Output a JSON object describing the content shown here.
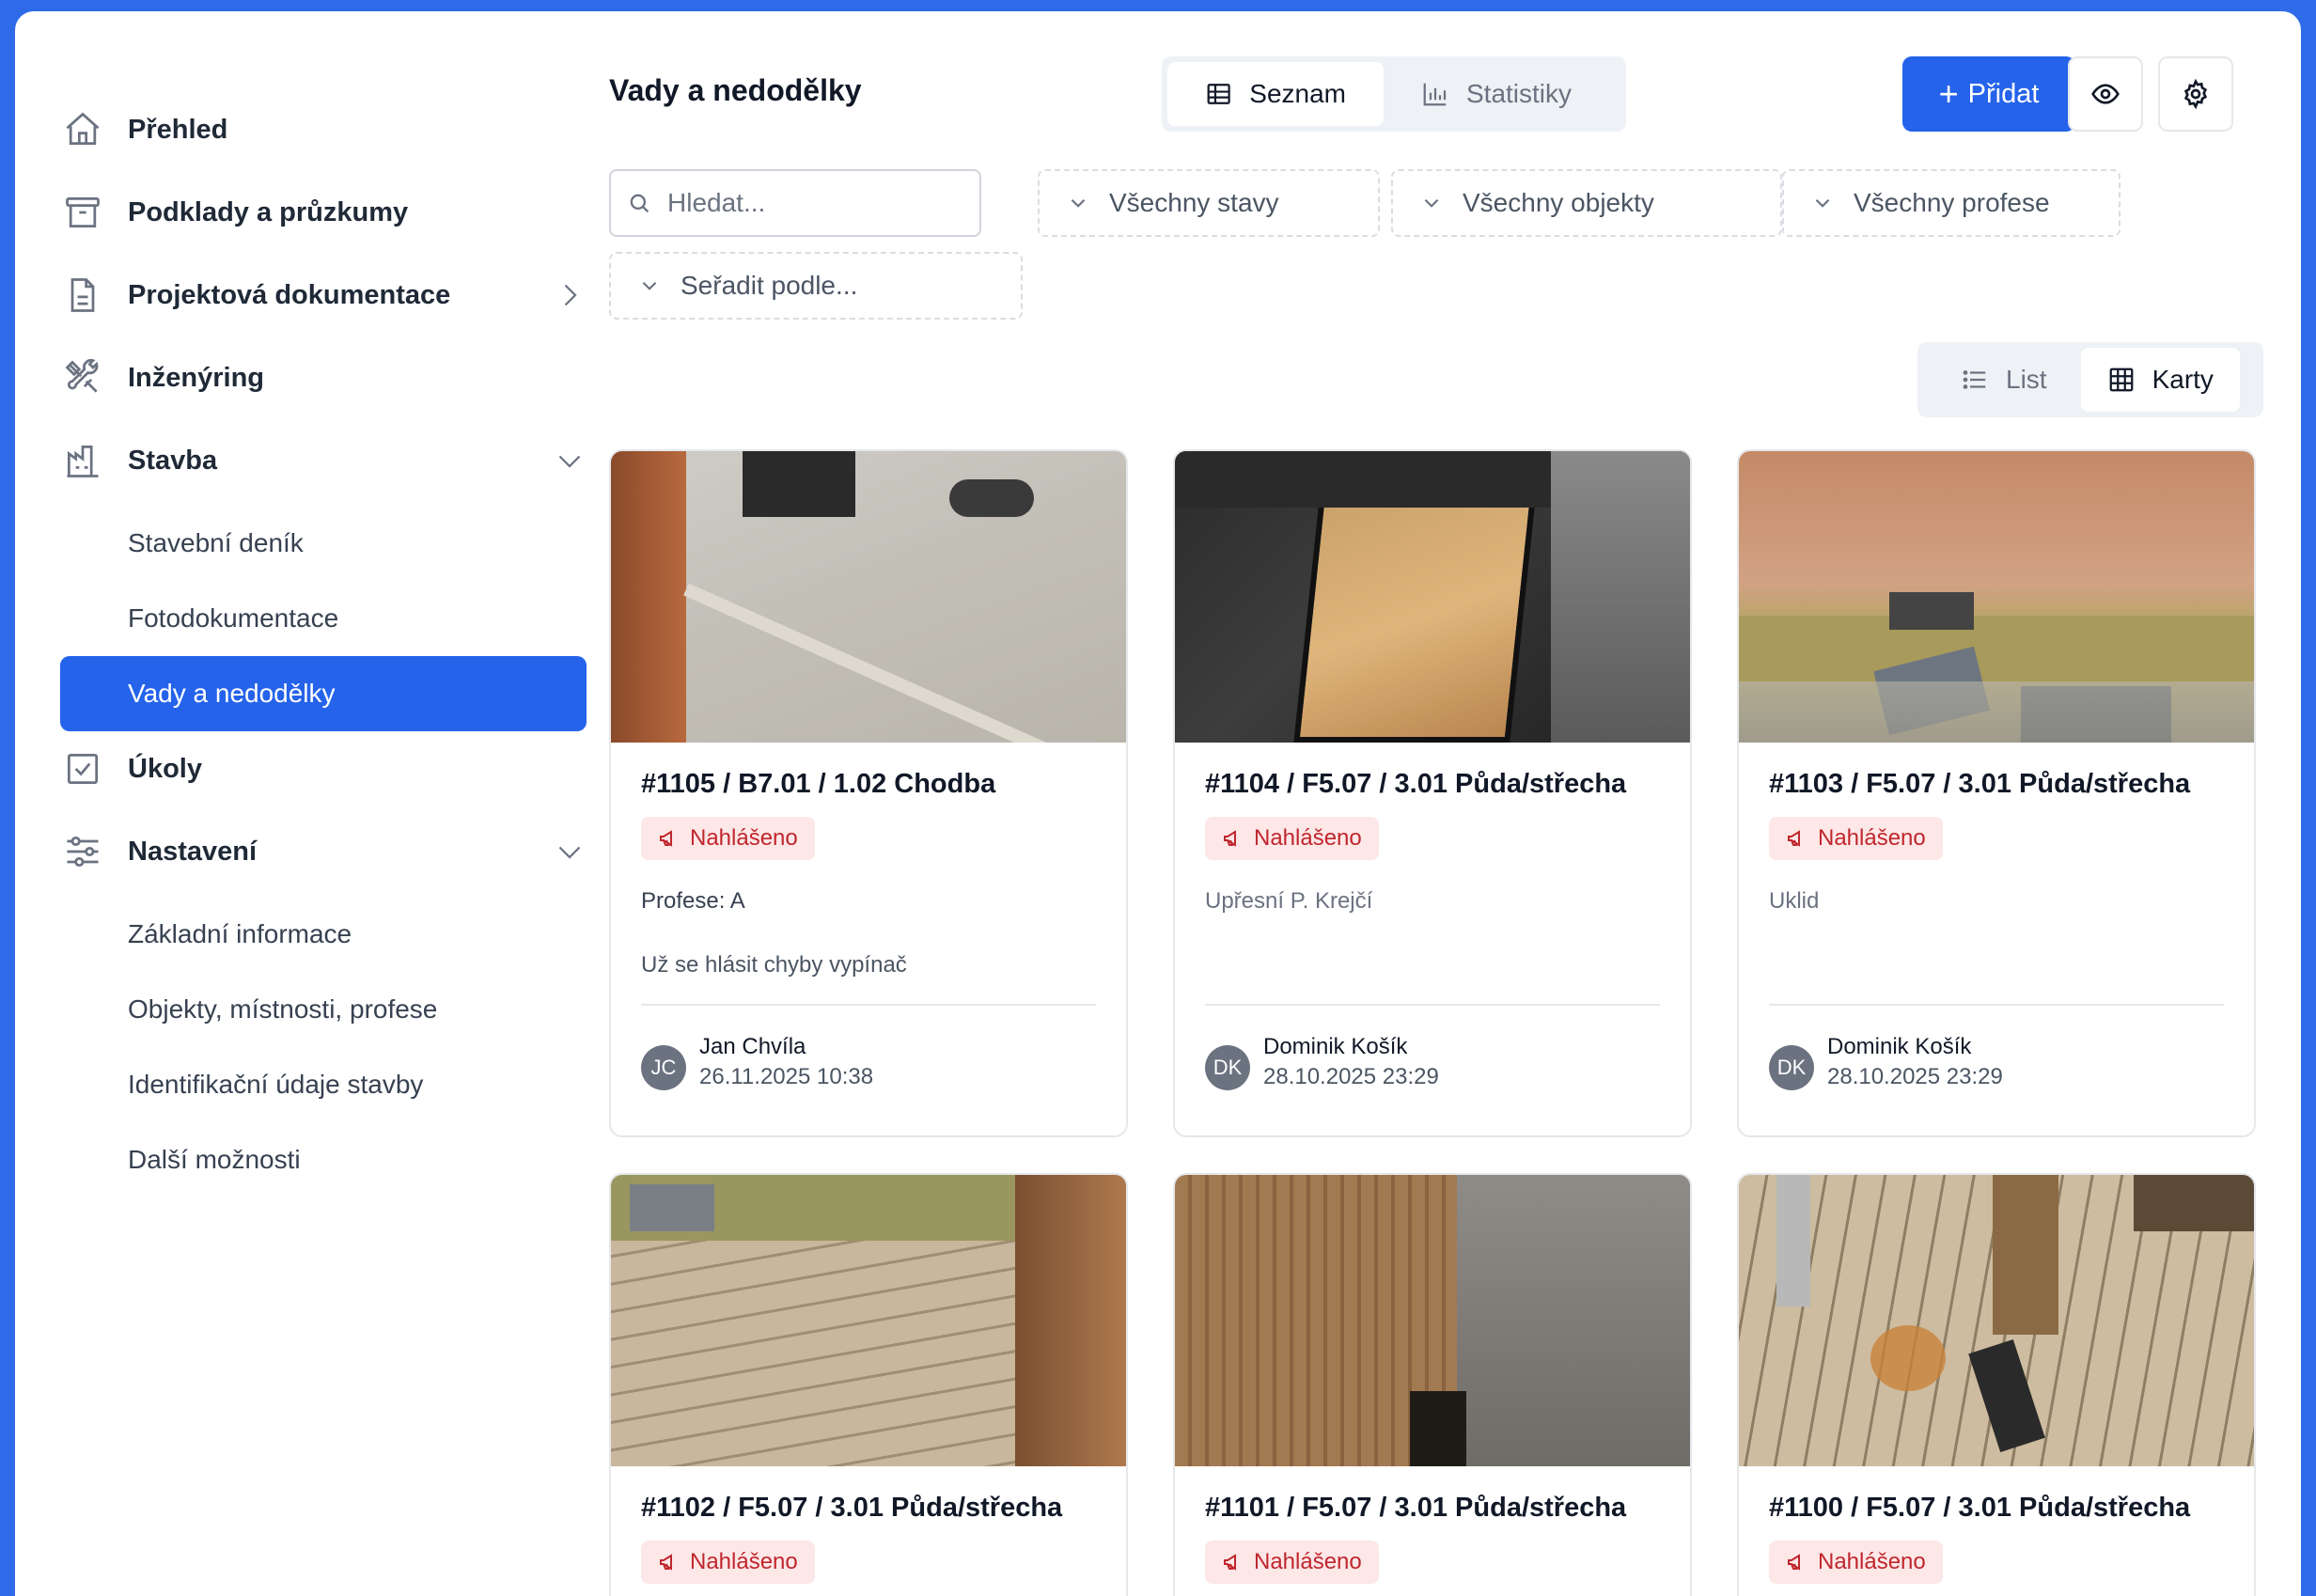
{
  "sidebar": {
    "items": [
      {
        "label": "Přehled"
      },
      {
        "label": "Podklady a průzkumy"
      },
      {
        "label": "Projektová dokumentace"
      },
      {
        "label": "Inženýring"
      },
      {
        "label": "Stavba"
      }
    ],
    "stavba_sub": [
      "Stavební deník",
      "Fotodokumentace",
      "Vady a nedodělky"
    ],
    "ukoly": "Úkoly",
    "nastaveni": "Nastavení",
    "nastaveni_sub": [
      "Základní informace",
      "Objekty, místnosti, profese",
      "Identifikační údaje stavby",
      "Další možnosti"
    ]
  },
  "header": {
    "title": "Vady a nedodělky",
    "tabs": [
      "Seznam",
      "Statistiky"
    ],
    "add_label": "Přidat"
  },
  "filters": {
    "search_placeholder": "Hledat...",
    "states": "Všechny stavy",
    "objects": "Všechny objekty",
    "professions": "Všechny profese",
    "sort": "Seřadit podle..."
  },
  "view_toggle": [
    "List",
    "Karty"
  ],
  "colors": {
    "accent": "#2563eb",
    "badge_bg": "#fde7e7",
    "badge_text": "#c0262d"
  },
  "cards": [
    {
      "title": "#1105 / B7.01 / 1.02 Chodba",
      "status": "Nahlášeno",
      "profession_key": "Profese:",
      "profession_val": "A",
      "note": "Už se hlásit chyby vypínač",
      "initials": "JC",
      "author": "Jan Chvíla",
      "date": "26.11.2025 10:38"
    },
    {
      "title": "#1104 / F5.07 / 3.01 Půda/střecha",
      "status": "Nahlášeno",
      "note": "Upřesní P. Krejčí",
      "initials": "DK",
      "author": "Dominik Košík",
      "date": "28.10.2025 23:29"
    },
    {
      "title": "#1103 / F5.07 / 3.01 Půda/střecha",
      "status": "Nahlášeno",
      "note": "Uklid",
      "initials": "DK",
      "author": "Dominik Košík",
      "date": "28.10.2025 23:29"
    },
    {
      "title": "#1102 / F5.07 / 3.01 Půda/střecha",
      "status": "Nahlášeno"
    },
    {
      "title": "#1101 / F5.07 / 3.01 Půda/střecha",
      "status": "Nahlášeno"
    },
    {
      "title": "#1100 / F5.07 / 3.01 Půda/střecha",
      "status": "Nahlášeno"
    }
  ]
}
